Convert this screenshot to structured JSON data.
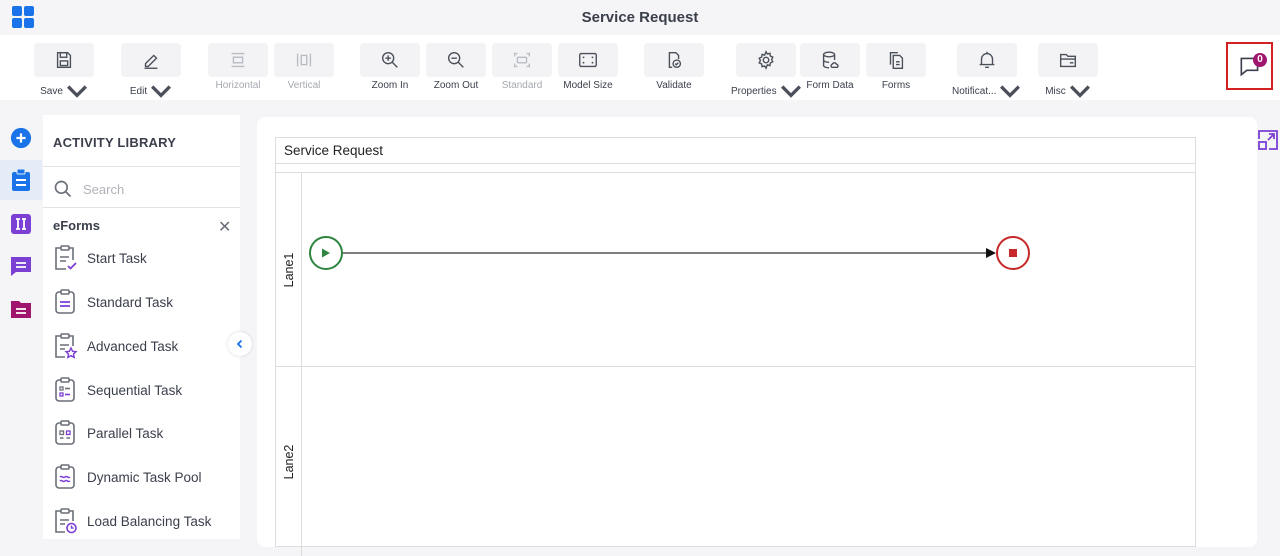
{
  "header": {
    "title": "Service Request",
    "app_icon": "app-grid-icon"
  },
  "toolbar": {
    "buttons": [
      {
        "label": "Save",
        "icon": "save-icon",
        "dropdown": true,
        "enabled": true
      },
      {
        "label": "Edit",
        "icon": "pencil-icon",
        "dropdown": true,
        "enabled": true
      },
      {
        "label": "Horizontal",
        "icon": "horizontal-layout-icon",
        "dropdown": false,
        "enabled": false
      },
      {
        "label": "Vertical",
        "icon": "vertical-layout-icon",
        "dropdown": false,
        "enabled": false
      },
      {
        "label": "Zoom In",
        "icon": "zoom-in-icon",
        "dropdown": false,
        "enabled": true
      },
      {
        "label": "Zoom Out",
        "icon": "zoom-out-icon",
        "dropdown": false,
        "enabled": true
      },
      {
        "label": "Standard",
        "icon": "standard-size-icon",
        "dropdown": false,
        "enabled": false
      },
      {
        "label": "Model Size",
        "icon": "model-size-icon",
        "dropdown": false,
        "enabled": true
      },
      {
        "label": "Validate",
        "icon": "validate-icon",
        "dropdown": false,
        "enabled": true
      },
      {
        "label": "Properties",
        "icon": "gear-icon",
        "dropdown": true,
        "enabled": true
      },
      {
        "label": "Form Data",
        "icon": "database-icon",
        "dropdown": false,
        "enabled": true
      },
      {
        "label": "Forms",
        "icon": "forms-icon",
        "dropdown": false,
        "enabled": true
      },
      {
        "label": "Notificat...",
        "icon": "bell-icon",
        "dropdown": true,
        "enabled": true
      },
      {
        "label": "Misc",
        "icon": "folder-icon",
        "dropdown": true,
        "enabled": true
      }
    ],
    "comments": {
      "icon": "comment-icon",
      "count": "0"
    }
  },
  "rail": [
    {
      "icon": "add-icon",
      "color": "#1a73e8"
    },
    {
      "icon": "clipboard-icon",
      "color": "#1a73e8",
      "active": true
    },
    {
      "icon": "variables-icon",
      "color": "#7b3fd4"
    },
    {
      "icon": "message-icon",
      "color": "#7b3fd4"
    },
    {
      "icon": "folder-doc-icon",
      "color": "#a0166e"
    }
  ],
  "library": {
    "title": "ACTIVITY LIBRARY",
    "search_placeholder": "Search",
    "category": "eForms",
    "items": [
      {
        "label": "Start Task",
        "icon": "start-task-icon"
      },
      {
        "label": "Standard Task",
        "icon": "standard-task-icon"
      },
      {
        "label": "Advanced Task",
        "icon": "advanced-task-icon"
      },
      {
        "label": "Sequential Task",
        "icon": "sequential-task-icon"
      },
      {
        "label": "Parallel Task",
        "icon": "parallel-task-icon"
      },
      {
        "label": "Dynamic Task Pool",
        "icon": "dynamic-task-pool-icon"
      },
      {
        "label": "Load Balancing Task",
        "icon": "load-balancing-task-icon"
      }
    ]
  },
  "canvas": {
    "pool_title": "Service Request",
    "lanes": [
      {
        "label": "Lane1"
      },
      {
        "label": "Lane2"
      }
    ],
    "nodes": [
      {
        "type": "start-event",
        "lane": "Lane1",
        "color": "#2e8540"
      },
      {
        "type": "end-event",
        "lane": "Lane1",
        "color": "#c62828"
      }
    ],
    "connections": [
      {
        "from": "start-event",
        "to": "end-event"
      }
    ]
  }
}
